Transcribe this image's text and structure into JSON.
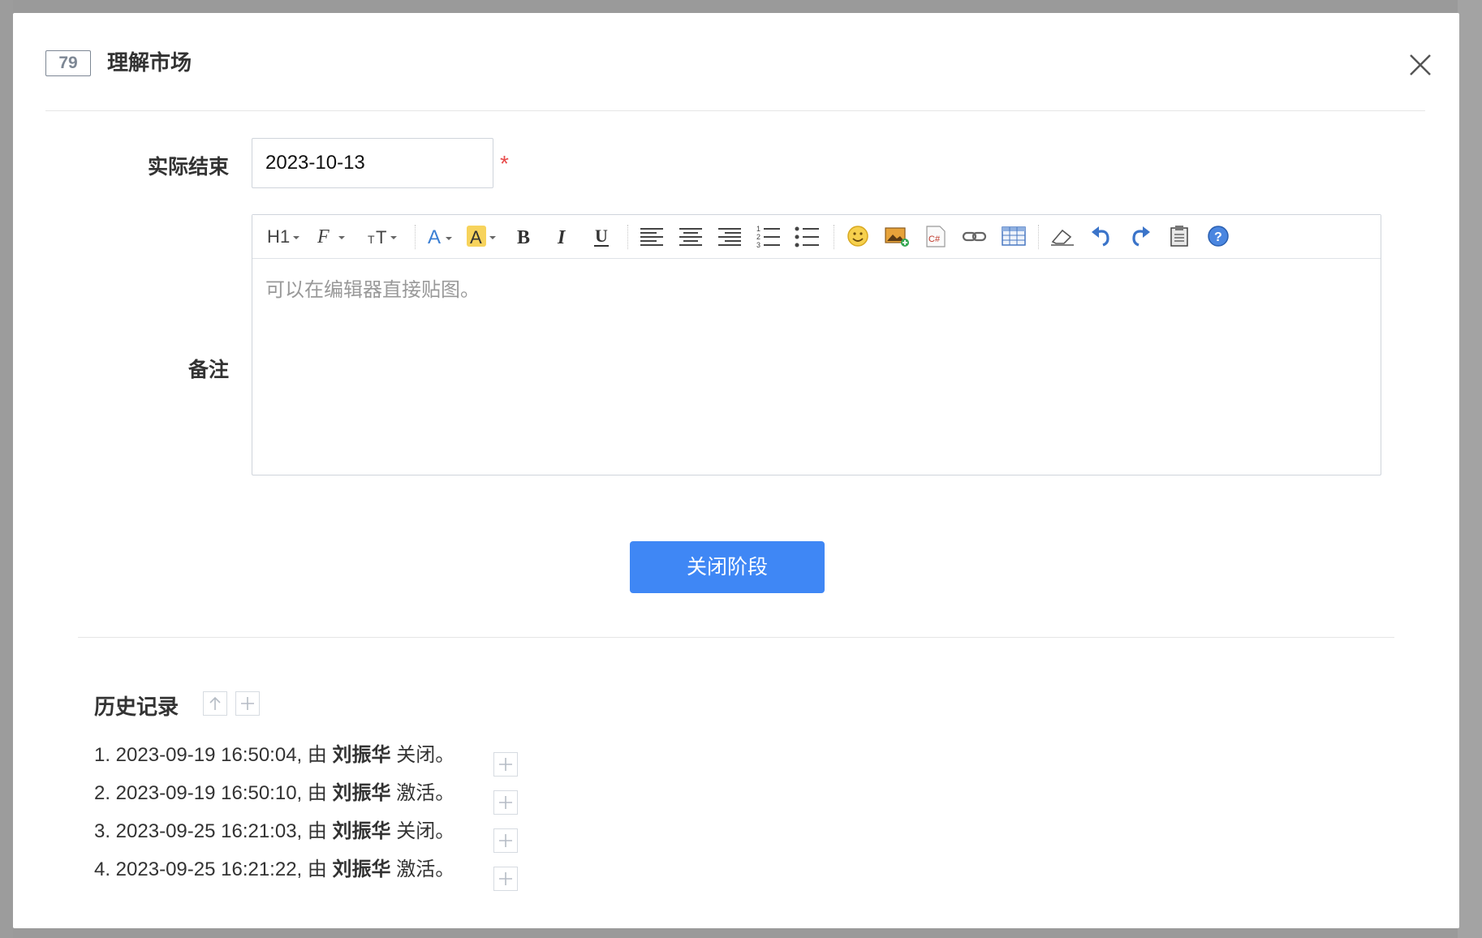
{
  "dialog": {
    "id_badge": "79",
    "title": "理解市场"
  },
  "form": {
    "actual_end_label": "实际结束",
    "actual_end_value": "2023-10-13",
    "required_mark": "*",
    "remark_label": "备注",
    "editor_placeholder": "可以在编辑器直接贴图。",
    "toolbar_icons": [
      "heading-icon",
      "font-family-icon",
      "font-size-icon",
      "font-color-icon",
      "highlight-color-icon",
      "bold-icon",
      "italic-icon",
      "underline-icon",
      "align-left-icon",
      "align-center-icon",
      "align-right-icon",
      "ordered-list-icon",
      "unordered-list-icon",
      "emoji-icon",
      "insert-image-icon",
      "code-icon",
      "link-icon",
      "table-icon",
      "eraser-icon",
      "undo-icon",
      "redo-icon",
      "paste-icon",
      "help-icon"
    ],
    "submit_label": "关闭阶段"
  },
  "history": {
    "title": "历史记录",
    "items": [
      {
        "prefix": "1. 2023-09-19 16:50:04, 由 ",
        "user": "刘振华",
        "action": " 关闭。"
      },
      {
        "prefix": "2. 2023-09-19 16:50:10, 由 ",
        "user": "刘振华",
        "action": " 激活。"
      },
      {
        "prefix": "3. 2023-09-25 16:21:03, 由 ",
        "user": "刘振华",
        "action": " 关闭。"
      },
      {
        "prefix": "4. 2023-09-25 16:21:22, 由 ",
        "user": "刘振华",
        "action": " 激活。"
      }
    ]
  },
  "colors": {
    "primary": "#3f87f5",
    "required": "#e84a4a",
    "border": "#cfd4db",
    "overlay": "#8e8e8e"
  }
}
